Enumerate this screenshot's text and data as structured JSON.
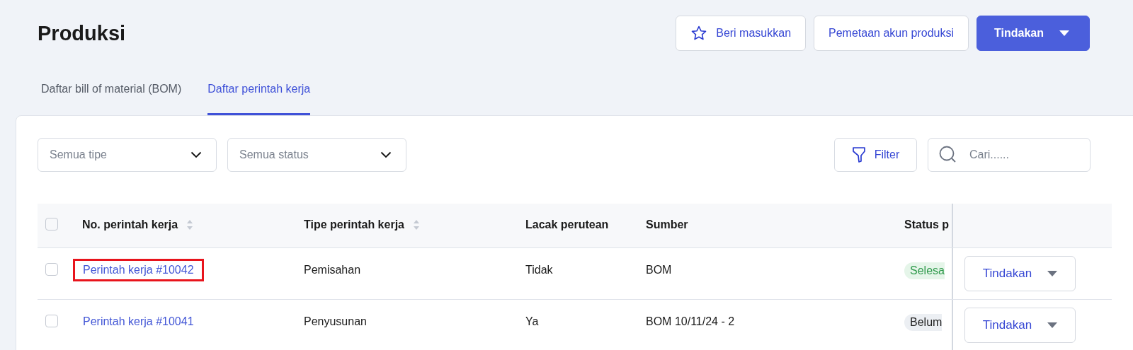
{
  "page": {
    "title": "Produksi"
  },
  "header_buttons": [
    {
      "kind": "feedback",
      "label": "Beri masukkan"
    },
    {
      "kind": "plain",
      "label": "Pemetaan akun produksi"
    },
    {
      "kind": "primary",
      "label": "Tindakan"
    }
  ],
  "tabs": [
    {
      "label": "Daftar bill of material (BOM)",
      "selected": false
    },
    {
      "label": "Daftar perintah kerja",
      "selected": true
    }
  ],
  "filters": {
    "dropdowns": [
      {
        "placeholder": "Semua tipe"
      },
      {
        "placeholder": "Semua status"
      }
    ],
    "filter_button": "Filter",
    "search": {
      "placeholder": "Cari......"
    }
  },
  "table": {
    "select_all": {
      "checked": false
    },
    "columns": [
      {
        "label": "No. perintah kerja",
        "sortable": true
      },
      {
        "label": "Tipe perintah kerja",
        "sortable": true
      },
      {
        "label": "Lacak perutean",
        "sortable": false
      },
      {
        "label": "Sumber",
        "sortable": false
      },
      {
        "label": "Status p"
      }
    ],
    "rows": [
      {
        "checked": false,
        "highlighted": true,
        "number": "Perintah kerja #10042",
        "type": "Pemisahan",
        "routing": "Tidak",
        "source": "BOM",
        "status": {
          "kind": "done",
          "label": "Selesa"
        },
        "action": "Tindakan"
      },
      {
        "checked": false,
        "highlighted": false,
        "number": "Perintah kerja #10041",
        "type": "Penyusunan",
        "routing": "Ya",
        "source": "BOM 10/11/24 - 2",
        "status": {
          "kind": "pending",
          "label": "Belum"
        },
        "action": "Tindakan"
      }
    ]
  }
}
